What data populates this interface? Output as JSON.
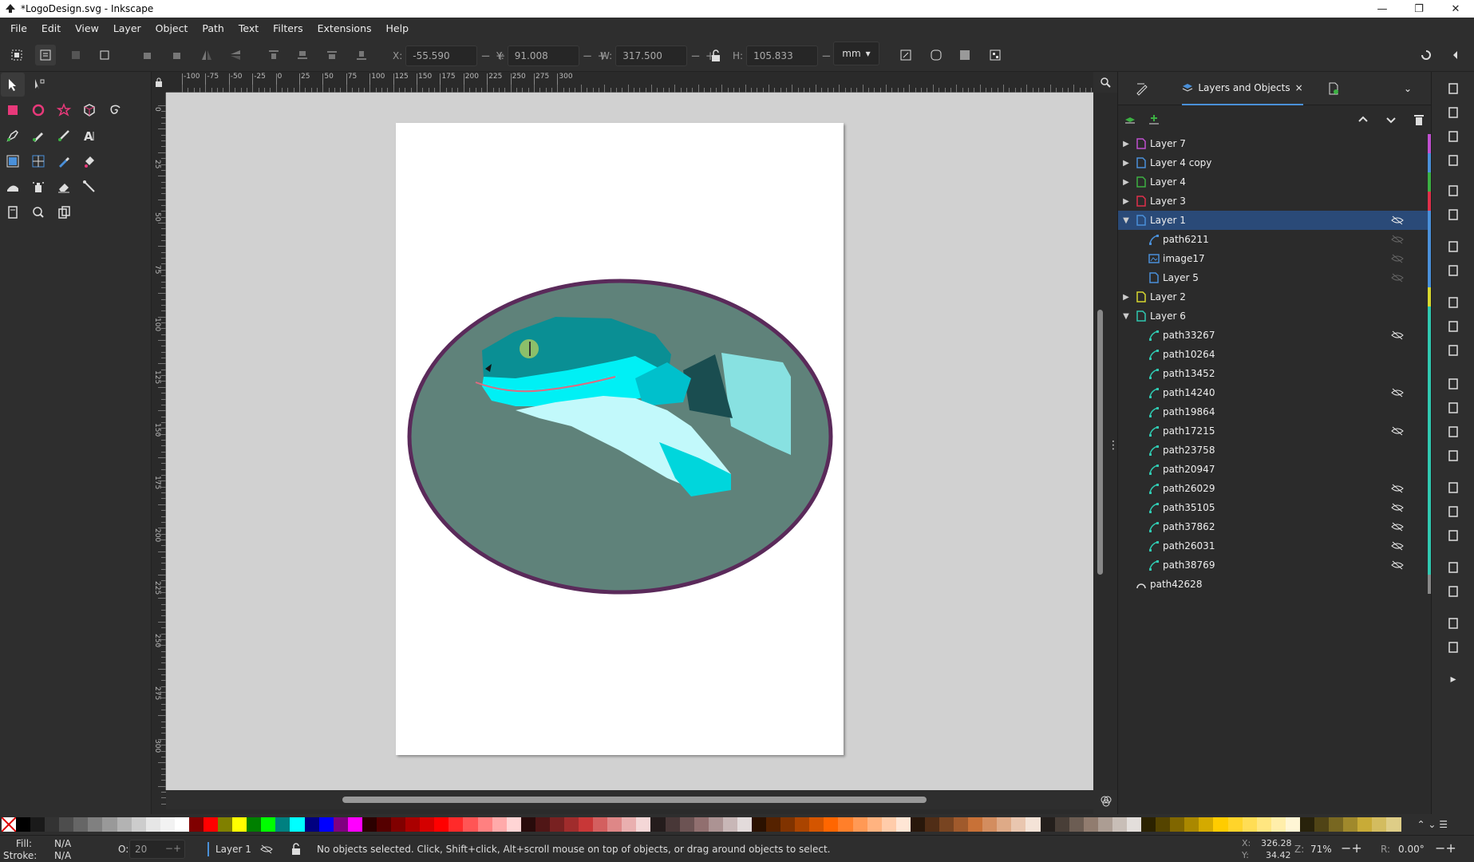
{
  "window": {
    "title": "*LogoDesign.svg - Inkscape",
    "min": "—",
    "max": "❐",
    "close": "✕"
  },
  "menu": [
    "File",
    "Edit",
    "View",
    "Layer",
    "Object",
    "Path",
    "Text",
    "Filters",
    "Extensions",
    "Help"
  ],
  "controls": {
    "x": {
      "label": "X:",
      "value": "-55.590"
    },
    "y": {
      "label": "Y:",
      "value": "91.008"
    },
    "w": {
      "label": "W:",
      "value": "317.500"
    },
    "h": {
      "label": "H:",
      "value": "105.833"
    },
    "units": "mm"
  },
  "ruler": {
    "top": [
      "-100",
      "-75",
      "-50",
      "-25",
      "0",
      "25",
      "50",
      "75",
      "100",
      "125",
      "150",
      "175",
      "200",
      "225",
      "250",
      "275",
      "300"
    ],
    "left": [
      "0",
      "25",
      "50",
      "75",
      "100",
      "125",
      "150",
      "175",
      "200",
      "225",
      "250",
      "275",
      "300"
    ]
  },
  "dock": {
    "tab_label": "Layers and Objects",
    "tab_close": "×",
    "rows": [
      {
        "name": "Layer 7",
        "depth": 0,
        "expand": "right",
        "icon": "layer-icon",
        "color": "#c050d0",
        "eye": false
      },
      {
        "name": "Layer 4 copy",
        "depth": 0,
        "expand": "right",
        "icon": "layer-icon",
        "color": "#4a90d9",
        "eye": false
      },
      {
        "name": "Layer 4",
        "depth": 0,
        "expand": "right",
        "icon": "layer-icon",
        "color": "#3cb043",
        "eye": false
      },
      {
        "name": "Layer 3",
        "depth": 0,
        "expand": "right",
        "icon": "layer-icon",
        "color": "#e0304a",
        "eye": false
      },
      {
        "name": "Layer 1",
        "depth": 0,
        "expand": "down",
        "icon": "layer-icon",
        "color": "#4a90d9",
        "eye": true,
        "selected": true
      },
      {
        "name": "path6211",
        "depth": 1,
        "expand": "",
        "icon": "path-icon",
        "color": "#4a90d9",
        "eye": "faint"
      },
      {
        "name": "image17",
        "depth": 1,
        "expand": "",
        "icon": "image-icon",
        "color": "#4a90d9",
        "eye": "faint"
      },
      {
        "name": "Layer 5",
        "depth": 1,
        "expand": "",
        "icon": "layer-icon",
        "color": "#4a90d9",
        "eye": "faint"
      },
      {
        "name": "Layer 2",
        "depth": 0,
        "expand": "right",
        "icon": "layer-icon",
        "color": "#d8d830",
        "eye": false
      },
      {
        "name": "Layer 6",
        "depth": 0,
        "expand": "down",
        "icon": "layer-icon",
        "color": "#30c8b0",
        "eye": false
      },
      {
        "name": "path33267",
        "depth": 1,
        "expand": "",
        "icon": "path-icon",
        "color": "#30c8b0",
        "eye": true
      },
      {
        "name": "path10264",
        "depth": 1,
        "expand": "",
        "icon": "path-icon",
        "color": "#30c8b0",
        "eye": false
      },
      {
        "name": "path13452",
        "depth": 1,
        "expand": "",
        "icon": "path-icon",
        "color": "#30c8b0",
        "eye": false
      },
      {
        "name": "path14240",
        "depth": 1,
        "expand": "",
        "icon": "path-icon",
        "color": "#30c8b0",
        "eye": true
      },
      {
        "name": "path19864",
        "depth": 1,
        "expand": "",
        "icon": "path-icon",
        "color": "#30c8b0",
        "eye": false
      },
      {
        "name": "path17215",
        "depth": 1,
        "expand": "",
        "icon": "path-icon",
        "color": "#30c8b0",
        "eye": true
      },
      {
        "name": "path23758",
        "depth": 1,
        "expand": "",
        "icon": "path-icon",
        "color": "#30c8b0",
        "eye": false
      },
      {
        "name": "path20947",
        "depth": 1,
        "expand": "",
        "icon": "path-icon",
        "color": "#30c8b0",
        "eye": false
      },
      {
        "name": "path26029",
        "depth": 1,
        "expand": "",
        "icon": "path-icon",
        "color": "#30c8b0",
        "eye": true
      },
      {
        "name": "path35105",
        "depth": 1,
        "expand": "",
        "icon": "path-icon",
        "color": "#30c8b0",
        "eye": true
      },
      {
        "name": "path37862",
        "depth": 1,
        "expand": "",
        "icon": "path-icon",
        "color": "#30c8b0",
        "eye": true
      },
      {
        "name": "path26031",
        "depth": 1,
        "expand": "",
        "icon": "path-icon",
        "color": "#30c8b0",
        "eye": true
      },
      {
        "name": "path38769",
        "depth": 1,
        "expand": "",
        "icon": "path-icon",
        "color": "#30c8b0",
        "eye": true
      },
      {
        "name": "path42628",
        "depth": 0,
        "expand": "",
        "icon": "arc-icon",
        "color": "#888888",
        "eye": false
      }
    ]
  },
  "status": {
    "fill_label": "Fill:",
    "fill_value": "N/A",
    "stroke_label": "Stroke:",
    "stroke_value": "N/A",
    "opacity_label": "O:",
    "opacity_value": "20",
    "layer": "Layer 1",
    "message": "No objects selected. Click, Shift+click, Alt+scroll mouse on top of objects, or drag around objects to select.",
    "x_label": "X:",
    "x_value": "326.28",
    "y_label": "Y:",
    "y_value": "34.42",
    "zoom_label": "Z:",
    "zoom_value": "71%",
    "rot_label": "R:",
    "rot_value": "0.00°"
  },
  "colors": {
    "accent": "#4a90d9",
    "ellipse_fill": "#5f827a",
    "ellipse_stroke": "#5a2a5a",
    "snake_dark": "#0a8f94",
    "snake_bright": "#00f0f5"
  },
  "palette": [
    "#000000",
    "#1a1a1a",
    "#333333",
    "#4d4d4d",
    "#666666",
    "#808080",
    "#999999",
    "#b3b3b3",
    "#cccccc",
    "#e6e6e6",
    "#f2f2f2",
    "#ffffff",
    "#800000",
    "#ff0000",
    "#808000",
    "#ffff00",
    "#008000",
    "#00ff00",
    "#008080",
    "#00ffff",
    "#000080",
    "#0000ff",
    "#800080",
    "#ff00ff",
    "#2b0000",
    "#550000",
    "#800000",
    "#aa0000",
    "#d40000",
    "#ff0000",
    "#ff2a2a",
    "#ff5555",
    "#ff8080",
    "#ffaaaa",
    "#ffd5d5",
    "#280b0b",
    "#501616",
    "#782121",
    "#a02c2c",
    "#c83737",
    "#d35f5f",
    "#de8787",
    "#e9afaf",
    "#f4d7d7",
    "#241c1c",
    "#483737",
    "#6c5353",
    "#916f6f",
    "#ac9393",
    "#c8b7b7",
    "#e3dbdb",
    "#2b1100",
    "#552200",
    "#803300",
    "#aa4400",
    "#d45500",
    "#ff6600",
    "#ff7f2a",
    "#ff9955",
    "#ffb380",
    "#ffccaa",
    "#ffe6d5",
    "#28170b",
    "#502d16",
    "#784421",
    "#a05a2c",
    "#c87137",
    "#d38d5f",
    "#deaa87",
    "#e9c6af",
    "#f4e3d7",
    "#241f1c",
    "#483e37",
    "#6c5d53",
    "#917c6f",
    "#ac9d93",
    "#c8beb7",
    "#e3dedb",
    "#2b2200",
    "#554400",
    "#806600",
    "#aa8800",
    "#d4aa00",
    "#ffcc00",
    "#ffd42a",
    "#ffdd55",
    "#ffe680",
    "#ffeeaa",
    "#fff6d5",
    "#28220b",
    "#504416",
    "#786721",
    "#a0892c",
    "#c8ab37",
    "#d3bc5f",
    "#decd87"
  ]
}
